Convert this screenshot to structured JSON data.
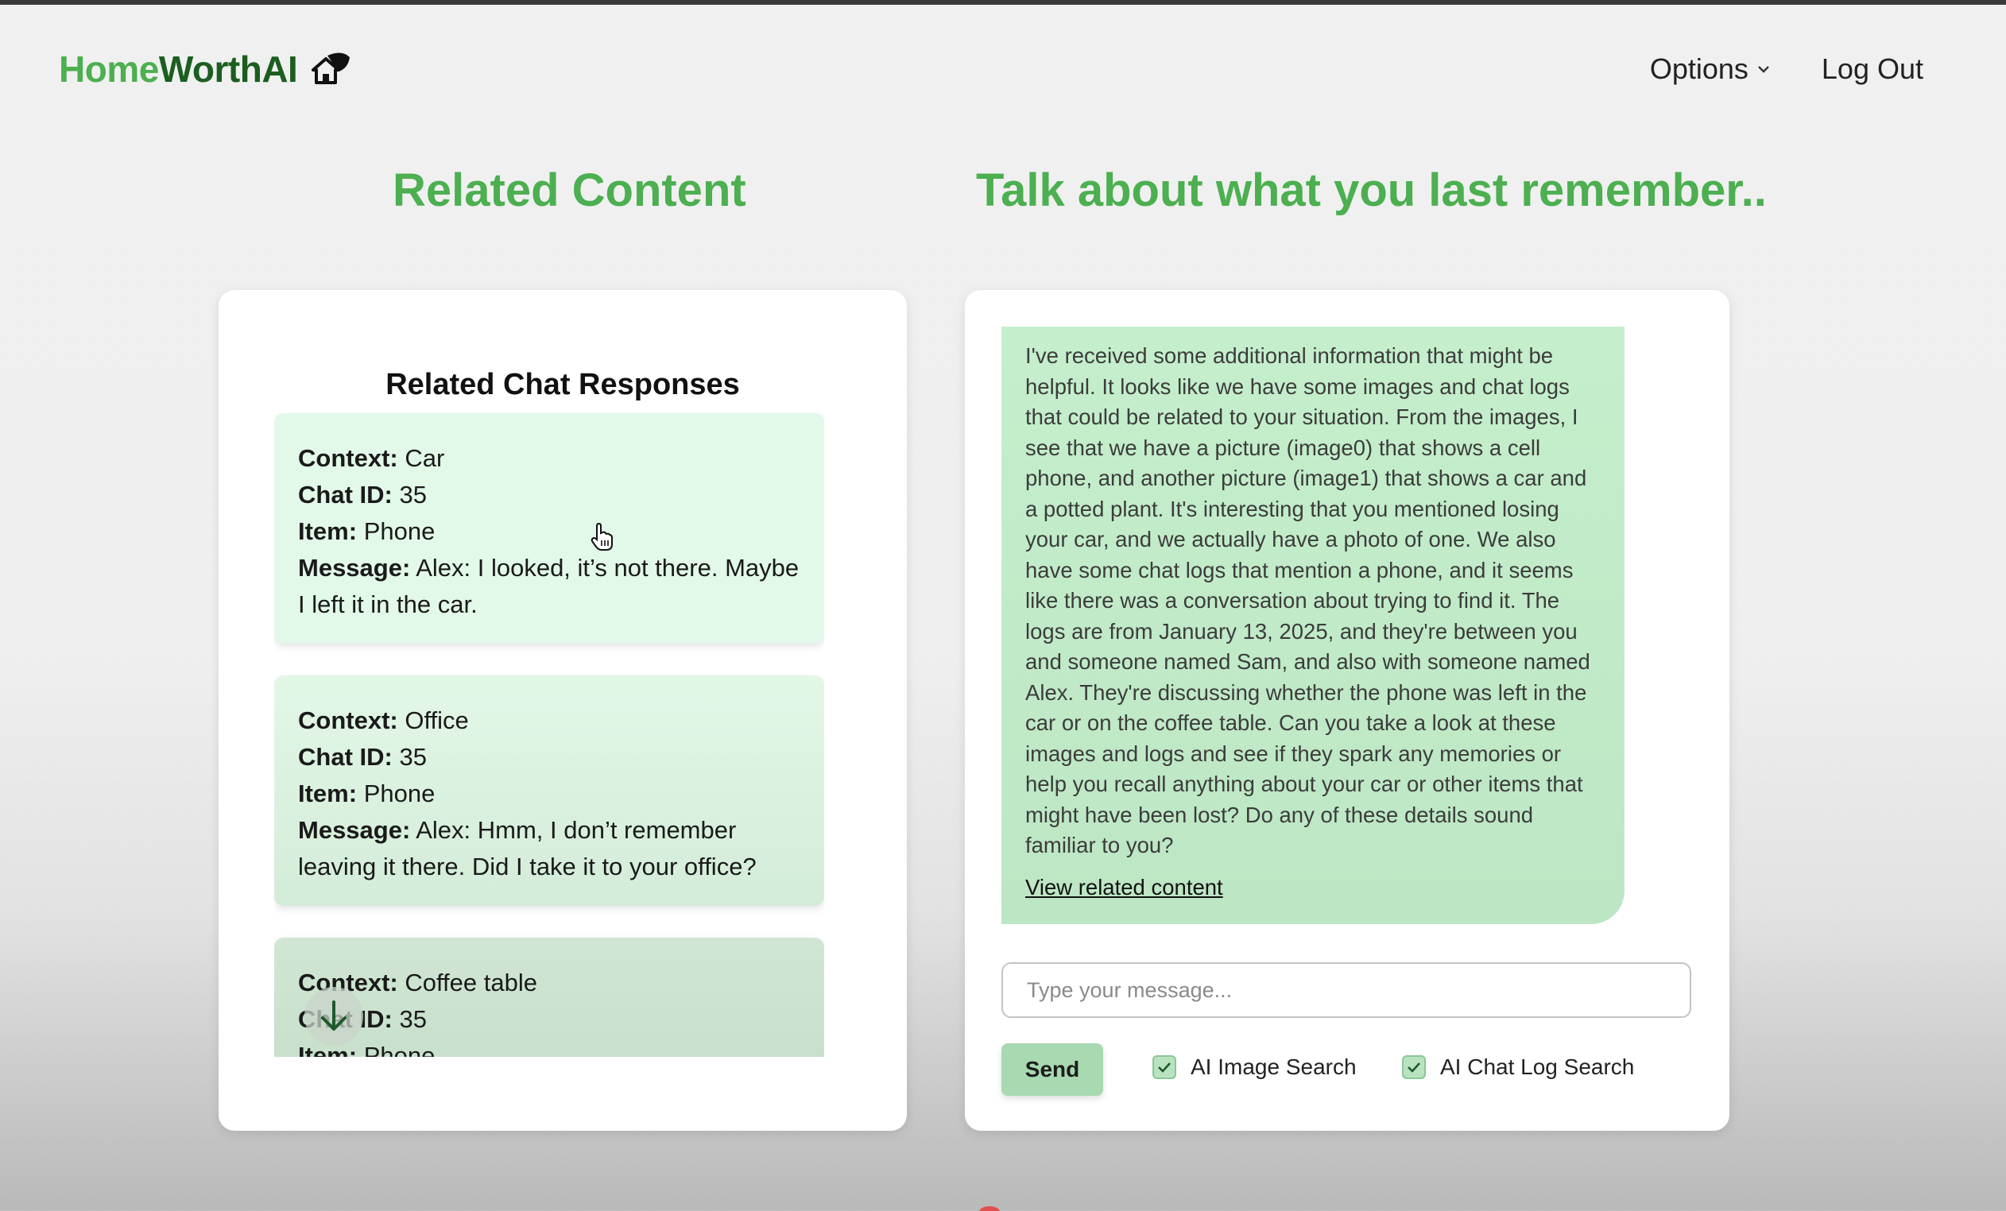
{
  "header": {
    "brand_part1": "Home",
    "brand_part2": "Worth",
    "brand_part3": "AI",
    "brand_icon": "house-icon",
    "nav": {
      "options_label": "Options",
      "logout_label": "Log Out"
    }
  },
  "headings": {
    "left": "Related Content",
    "right": "Talk about what you last remember.."
  },
  "related": {
    "title": "Related Chat Responses",
    "field_labels": {
      "context": "Context:",
      "chat_id": "Chat ID:",
      "item": "Item:",
      "message": "Message:"
    },
    "responses": [
      {
        "context": "Car",
        "chat_id": "35",
        "item": "Phone",
        "message": "Alex: I looked, it’s not there. Maybe I left it in the car."
      },
      {
        "context": "Office",
        "chat_id": "35",
        "item": "Phone",
        "message": "Alex: Hmm, I don’t remember leaving it there. Did I take it to your office?"
      },
      {
        "context": "Coffee table",
        "chat_id": "35",
        "item": "Phone"
      }
    ],
    "scroll_icon": "arrow-down-icon"
  },
  "chat": {
    "ai_message": "I've received some additional information that might be helpful. It looks like we have some images and chat logs that could be related to your situation. From the images, I see that we have a picture (image0) that shows a cell phone, and another picture (image1) that shows a car and a potted plant. It's interesting that you mentioned losing your car, and we actually have a photo of one. We also have some chat logs that mention a phone, and it seems like there was a conversation about trying to find it. The logs are from January 13, 2025, and they're between you and someone named Sam, and also with someone named Alex. They're discussing whether the phone was left in the car or on the coffee table. Can you take a look at these images and logs and see if they spark any memories or help you recall anything about your car or other items that might have been lost? Do any of these details sound familiar to you?",
    "view_related_link": "View related content",
    "input_placeholder": "Type your message...",
    "send_label": "Send",
    "options": [
      {
        "label": "AI Image Search",
        "checked": true
      },
      {
        "label": "AI Chat Log Search",
        "checked": true
      }
    ]
  },
  "colors": {
    "brand_green": "#4caf50",
    "brand_dark_green": "#1b5e20",
    "bubble_green": "#c5efcc",
    "card_green": "#e2f8e8"
  }
}
